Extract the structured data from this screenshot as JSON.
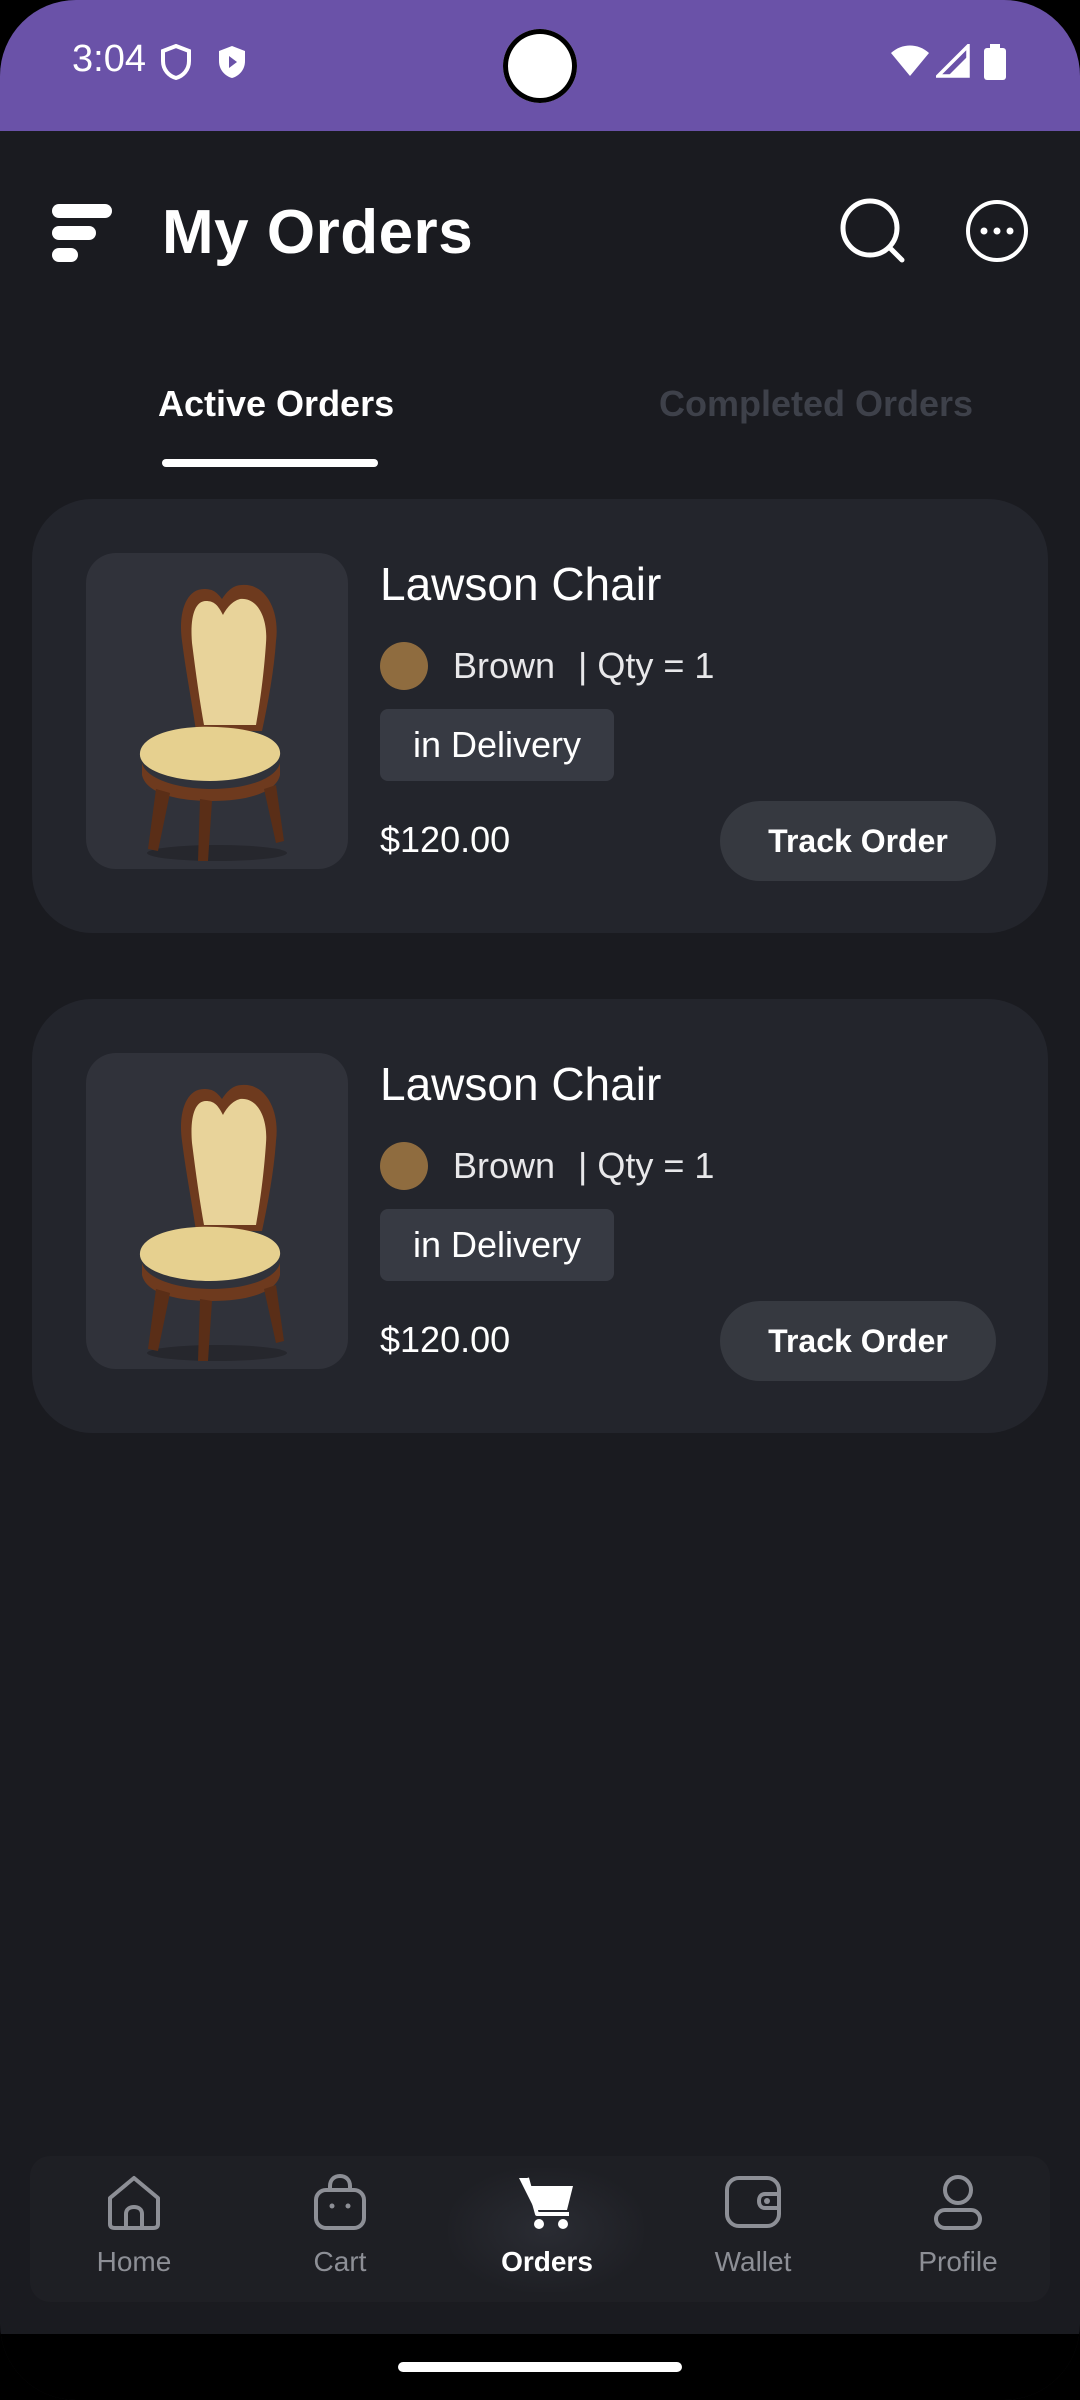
{
  "status_bar": {
    "time": "3:04"
  },
  "header": {
    "title": "My Orders",
    "menu_icon": "app-logo-icon",
    "search_icon": "search-icon",
    "more_icon": "more-options-icon"
  },
  "tabs": [
    {
      "label": "Active Orders",
      "active": true
    },
    {
      "label": "Completed Orders",
      "active": false
    }
  ],
  "orders": [
    {
      "name": "Lawson Chair",
      "color_name": "Brown",
      "color_hex": "#8f6c3f",
      "qty": "| Qty = 1",
      "status": "in Delivery",
      "price": "$120.00",
      "action": "Track Order"
    },
    {
      "name": "Lawson Chair",
      "color_name": "Brown",
      "color_hex": "#8f6c3f",
      "qty": "| Qty = 1",
      "status": "in Delivery",
      "price": "$120.00",
      "action": "Track Order"
    }
  ],
  "bottom_nav": [
    {
      "label": "Home",
      "icon": "home-icon",
      "active": false
    },
    {
      "label": "Cart",
      "icon": "cart-bag-icon",
      "active": false
    },
    {
      "label": "Orders",
      "icon": "shopping-cart-icon",
      "active": true
    },
    {
      "label": "Wallet",
      "icon": "wallet-icon",
      "active": false
    },
    {
      "label": "Profile",
      "icon": "profile-icon",
      "active": false
    }
  ],
  "colors": {
    "status_bar": "#6a52a8",
    "background": "#1a1b20",
    "card": "#23252c",
    "accent_text": "#ffffff"
  }
}
